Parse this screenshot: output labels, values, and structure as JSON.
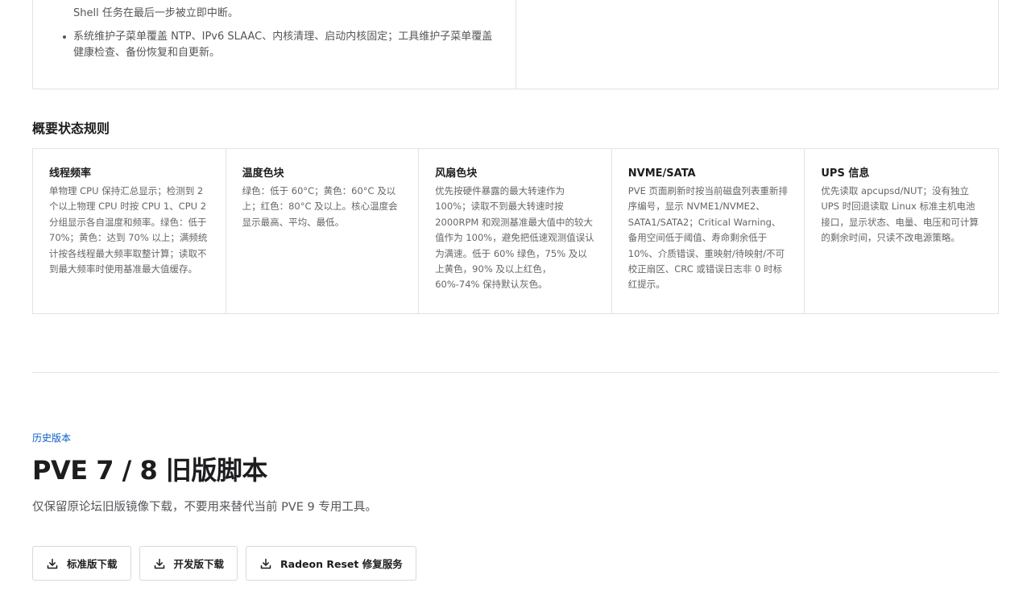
{
  "top_panel": {
    "partial_line_1": "Shell 任务在最后一步被立即中断。",
    "bullets": [
      "系统维护子菜单覆盖 NTP、IPv6 SLAAC、内核清理、启动内核固定；工具维护子菜单覆盖健康检查、备份恢复和自更新。"
    ]
  },
  "rules_section": {
    "title": "概要状态规则",
    "cards": [
      {
        "title": "线程频率",
        "desc": "单物理 CPU 保持汇总显示；检测到 2 个以上物理 CPU 时按 CPU 1、CPU 2 分组显示各自温度和频率。绿色：低于 70%；黄色：达到 70% 以上；满频统计按各线程最大频率取整计算；读取不到最大频率时使用基准最大值缓存。"
      },
      {
        "title": "温度色块",
        "desc": "绿色：低于 60°C；黄色：60°C 及以上；红色：80°C 及以上。核心温度会显示最高、平均、最低。"
      },
      {
        "title": "风扇色块",
        "desc": "优先按硬件暴露的最大转速作为 100%；读取不到最大转速时按 2000RPM 和观测基准最大值中的较大值作为 100%，避免把低速观测值误认为满速。低于 60% 绿色，75% 及以上黄色，90% 及以上红色，60%-74% 保持默认灰色。"
      },
      {
        "title": "NVME/SATA",
        "desc": "PVE 页面刷新时按当前磁盘列表重新排序编号，显示 NVME1/NVME2、SATA1/SATA2；Critical Warning、备用空间低于阈值、寿命剩余低于 10%、介质错误、重映射/待映射/不可校正扇区、CRC 或错误日志非 0 时标红提示。"
      },
      {
        "title": "UPS 信息",
        "desc": "优先读取 apcupsd/NUT；没有独立 UPS 时回退读取 Linux 标准主机电池接口，显示状态、电量、电压和可计算的剩余时间，只读不改电源策略。"
      }
    ]
  },
  "legacy": {
    "eyebrow": "历史版本",
    "title": "PVE 7 / 8 旧版脚本",
    "subtitle": "仅保留原论坛旧版镜像下载，不要用来替代当前 PVE 9 专用工具。",
    "buttons": [
      {
        "label": "标准版下载",
        "icon": "download-icon"
      },
      {
        "label": "开发版下载",
        "icon": "download-icon"
      },
      {
        "label": "Radeon Reset 修复服务",
        "icon": "download-icon"
      }
    ]
  },
  "colors": {
    "accent": "#0a5cc7",
    "border": "#e2e2e2",
    "text": "#1d1d1f",
    "muted": "#66666b"
  }
}
